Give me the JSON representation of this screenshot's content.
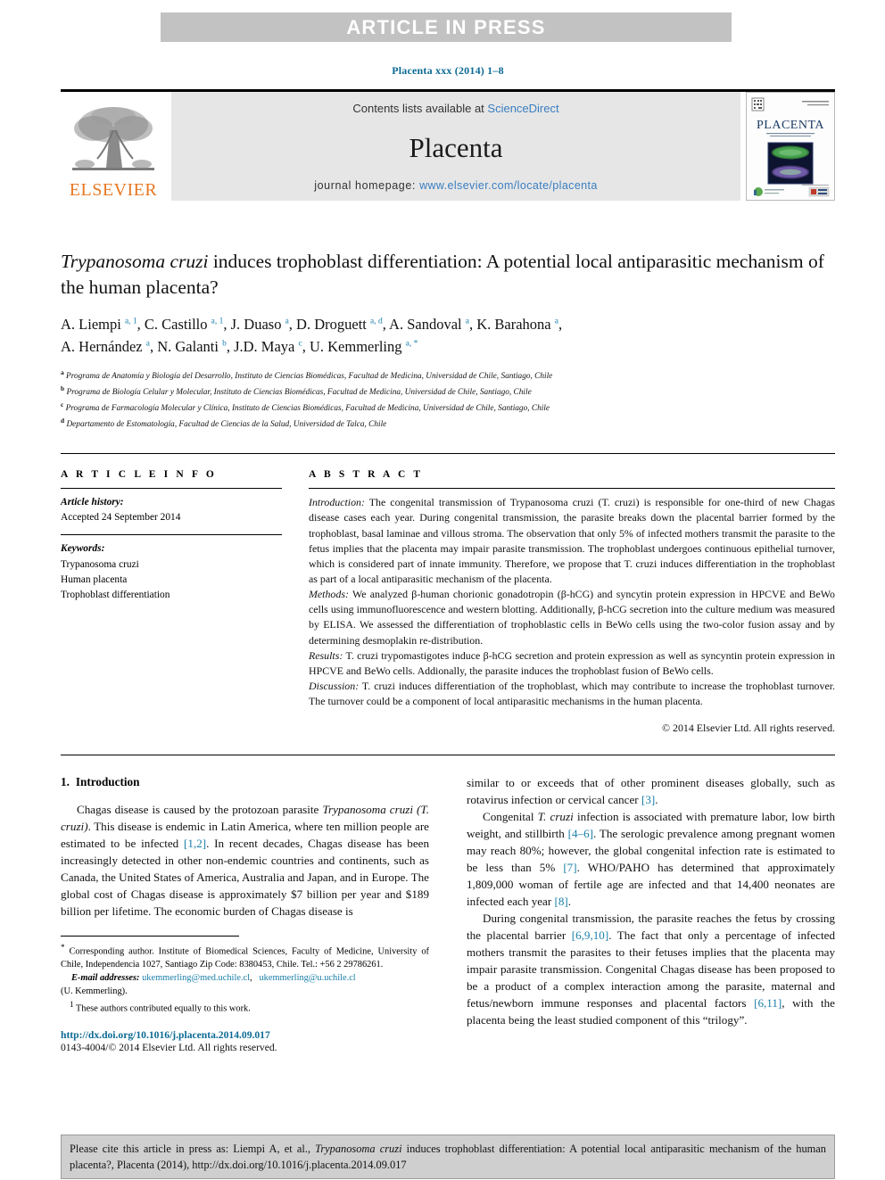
{
  "banner": {
    "text": "ARTICLE IN PRESS"
  },
  "header": {
    "journal_ref": "Placenta xxx (2014) 1–8",
    "contents_prefix": "Contents lists available at ",
    "sciencedirect": "ScienceDirect",
    "journal_name": "Placenta",
    "homepage_label": "journal homepage: ",
    "homepage_url": "www.elsevier.com/locate/placenta",
    "publisher": "ELSEVIER",
    "cover_title": "PLACENTA"
  },
  "article": {
    "title_part1_italic": "Trypanosoma cruzi",
    "title_rest": " induces trophoblast differentiation: A potential local antiparasitic mechanism of the human placenta?",
    "authors_line1": "A. Liempi a, 1, C. Castillo a, 1, J. Duaso a, D. Droguett a, d, A. Sandoval a, K. Barahona a,",
    "authors_line2": "A. Hernández a, N. Galanti b, J.D. Maya c, U. Kemmerling a, *",
    "affiliations": [
      {
        "mark": "a",
        "text": "Programa de Anatomía y Biología del Desarrollo, Instituto de Ciencias Biomédicas, Facultad de Medicina, Universidad de Chile, Santiago, Chile"
      },
      {
        "mark": "b",
        "text": "Programa de Biología Celular y Molecular, Instituto de Ciencias Biomédicas, Facultad de Medicina, Universidad de Chile, Santiago, Chile"
      },
      {
        "mark": "c",
        "text": "Programa de Farmacología Molecular y Clínica, Instituto de Ciencias Biomédicas, Facultad de Medicina, Universidad de Chile, Santiago, Chile"
      },
      {
        "mark": "d",
        "text": "Departamento de Estomatología, Facultad de Ciencias de la Salud, Universidad de Talca, Chile"
      }
    ]
  },
  "article_info": {
    "heading": "A R T I C L E  I N F O",
    "history_label": "Article history:",
    "history_value": "Accepted 24 September 2014",
    "keywords_label": "Keywords:",
    "keywords": [
      "Trypanosoma cruzi",
      "Human placenta",
      "Trophoblast differentiation"
    ]
  },
  "abstract": {
    "heading": "A B S T R A C T",
    "introduction_label": "Introduction:",
    "introduction_text": " The congenital transmission of Trypanosoma cruzi (T. cruzi) is responsible for one-third of new Chagas disease cases each year. During congenital transmission, the parasite breaks down the placental barrier formed by the trophoblast, basal laminae and villous stroma. The observation that only 5% of infected mothers transmit the parasite to the fetus implies that the placenta may impair parasite transmission. The trophoblast undergoes continuous epithelial turnover, which is considered part of innate immunity. Therefore, we propose that T. cruzi induces differentiation in the trophoblast as part of a local antiparasitic mechanism of the placenta.",
    "methods_label": "Methods:",
    "methods_text": " We analyzed β-human chorionic gonadotropin (β-hCG) and syncytin protein expression in HPCVE and BeWo cells using immunofluorescence and western blotting. Additionally, β-hCG secretion into the culture medium was measured by ELISA. We assessed the differentiation of trophoblastic cells in BeWo cells using the two-color fusion assay and by determining desmoplakin re-distribution.",
    "results_label": "Results:",
    "results_text": " T. cruzi trypomastigotes induce β-hCG secretion and protein expression as well as syncyntin protein expression in HPCVE and BeWo cells. Addionally, the parasite induces the trophoblast fusion of BeWo cells.",
    "discussion_label": "Discussion:",
    "discussion_text": " T. cruzi induces differentiation of the trophoblast, which may contribute to increase the trophoblast turnover. The turnover could be a component of local antiparasitic mechanisms in the human placenta.",
    "copyright": "© 2014 Elsevier Ltd. All rights reserved."
  },
  "introduction": {
    "number": "1.",
    "title": "Introduction",
    "para1_a": "Chagas disease is caused by the protozoan parasite ",
    "para1_italic": "Trypanosoma cruzi (T. cruzi)",
    "para1_b": ". This disease is endemic in Latin America, where ten million people are estimated to be infected ",
    "para1_ref1": "[1,2]",
    "para1_c": ". In recent decades, Chagas disease has been increasingly detected in other non-endemic countries and continents, such as Canada, the United States of America, Australia and Japan, and in Europe. The global cost of Chagas disease is approximately $7 billion per year and $189 billion per lifetime. The economic burden of Chagas disease is similar to or exceeds that of other prominent diseases globally, such as rotavirus infection or cervical cancer ",
    "para1_ref2": "[3]",
    "para1_d": ".",
    "para2_a": "Congenital ",
    "para2_italic": "T. cruzi",
    "para2_b": " infection is associated with premature labor, low birth weight, and stillbirth ",
    "para2_ref1": "[4–6]",
    "para2_c": ". The serologic prevalence among pregnant women may reach 80%; however, the global congenital infection rate is estimated to be less than 5% ",
    "para2_ref2": "[7]",
    "para2_d": ". WHO/PAHO has determined that approximately 1,809,000 woman of fertile age are infected and that 14,400 neonates are infected each year ",
    "para2_ref3": "[8]",
    "para2_e": ".",
    "para3_a": "During congenital transmission, the parasite reaches the fetus by crossing the placental barrier ",
    "para3_ref1": "[6,9,10]",
    "para3_b": ". The fact that only a percentage of infected mothers transmit the parasites to their fetuses implies that the placenta may impair parasite transmission. Congenital Chagas disease has been proposed to be a product of a complex interaction among the parasite, maternal and fetus/newborn immune responses and placental factors ",
    "para3_ref2": "[6,11]",
    "para3_c": ", with the placenta being the least studied component of this “trilogy”."
  },
  "footnotes": {
    "corresponding_mark": "*",
    "corresponding_text": " Corresponding author. Institute of Biomedical Sciences, Faculty of Medicine, University of Chile, Independencia 1027, Santiago Zip Code: 8380453, Chile. Tel.: +56 2 29786261.",
    "email_label": "E-mail addresses:",
    "email1": "ukemmerling@med.uchile.cl",
    "email2": "ukemmerling@u.uchile.cl",
    "email_suffix": "(U. Kemmerling).",
    "equal_mark": "1",
    "equal_text": " These authors contributed equally to this work.",
    "doi": "http://dx.doi.org/10.1016/j.placenta.2014.09.017",
    "issn": "0143-4004/© 2014 Elsevier Ltd. All rights reserved."
  },
  "cite_box": {
    "prefix": "Please cite this article in press as: Liempi A, et al., ",
    "italic": "Trypanosoma cruzi",
    "suffix": " induces trophoblast differentiation: A potential local antiparasitic mechanism of the human placenta?, Placenta (2014), http://dx.doi.org/10.1016/j.placenta.2014.09.017"
  },
  "colors": {
    "link": "#3a7ec0",
    "ref": "#1a7fa8",
    "journal_ref": "#0b6a94",
    "elsevier_orange": "#e87722",
    "banner_bg": "#c2c2c2",
    "panel_bg": "#e6e6e6",
    "cite_bg": "#cfcfcf"
  }
}
